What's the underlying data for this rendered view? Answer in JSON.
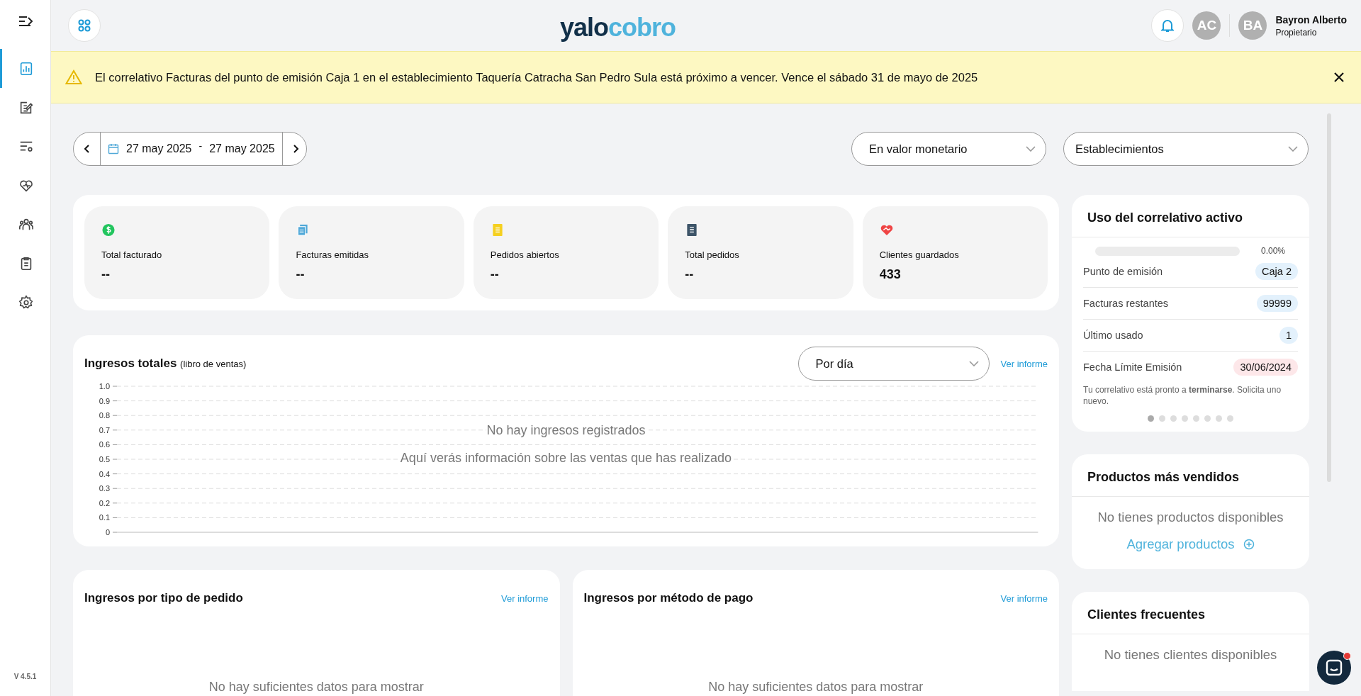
{
  "sidebar": {
    "items": [
      {
        "selected": true
      },
      {
        "selected": false
      },
      {
        "selected": false
      },
      {
        "selected": false
      },
      {
        "selected": false
      },
      {
        "selected": false
      },
      {
        "selected": false
      }
    ],
    "version": "V 4.5.1"
  },
  "header": {
    "logo": {
      "part_1": "yalo",
      "part_2": "cobro"
    },
    "account_initials": "AC",
    "user": {
      "initials": "BA",
      "name": "Bayron Alberto",
      "role": "Propietario"
    }
  },
  "alert": {
    "message": "El correlativo Facturas del punto de emisión Caja 1 en el establecimiento Taquería Catracha San Pedro Sula está próximo a vencer. Vence el sábado 31 de mayo de 2025"
  },
  "filters": {
    "date_from": "27 may 2025",
    "separator": "-",
    "date_to": "27 may 2025",
    "measure": "En valor monetario",
    "establishment": "Establecimientos"
  },
  "stats": [
    {
      "label": "Total facturado",
      "value": "--",
      "color": "#22c55e"
    },
    {
      "label": "Facturas emitidas",
      "value": "--",
      "color": "#4fa8d8"
    },
    {
      "label": "Pedidos abiertos",
      "value": "--",
      "color": "#f5d020"
    },
    {
      "label": "Total pedidos",
      "value": "--",
      "color": "#3d5468"
    },
    {
      "label": "Clientes guardados",
      "value": "433",
      "color": "#ef4444"
    }
  ],
  "revenue": {
    "title": "Ingresos totales",
    "subtitle": "(libro de ventas)",
    "period": "Por día",
    "link": "Ver informe",
    "empty_title": "No hay ingresos registrados",
    "empty_text": "Aquí verás información sobre las ventas que has realizado",
    "axis_labels": [
      "1.0",
      "0.9",
      "0.8",
      "0.7",
      "0.6",
      "0.5",
      "0.4",
      "0.3",
      "0.2",
      "0.1",
      "0"
    ]
  },
  "order_type": {
    "title": "Ingresos por tipo de pedido",
    "link": "Ver informe",
    "empty_text": "No hay suficientes datos para mostrar"
  },
  "payment_method": {
    "title": "Ingresos por método de pago",
    "link": "Ver informe",
    "empty_text": "No hay suficientes datos para mostrar"
  },
  "correlative": {
    "title": "Uso del correlativo activo",
    "level": 0,
    "percent": "0.00%",
    "rows": [
      {
        "label": "Punto de emisión",
        "value": "Caja 2",
        "kind": "info"
      },
      {
        "label": "Facturas restantes",
        "value": "99999",
        "kind": "info"
      },
      {
        "label": "Último usado",
        "value": "1",
        "kind": "info"
      },
      {
        "label": "Fecha Límite Emisión",
        "value": "30/06/2024",
        "kind": "warning"
      }
    ],
    "note": "Tu correlativo está pronto a **terminarse**. Solicita uno nuevo.",
    "dots": [
      {
        "selected": true
      },
      {
        "selected": false
      },
      {
        "selected": false
      },
      {
        "selected": false
      },
      {
        "selected": false
      },
      {
        "selected": false
      },
      {
        "selected": false
      },
      {
        "selected": false
      }
    ]
  },
  "top_products": {
    "title": "Productos más vendidos",
    "empty_text": "No tienes productos disponibles",
    "action": "Agregar productos"
  },
  "frequent_clients": {
    "title": "Clientes frecuentes",
    "empty_text": "No tienes clientes disponibles"
  }
}
